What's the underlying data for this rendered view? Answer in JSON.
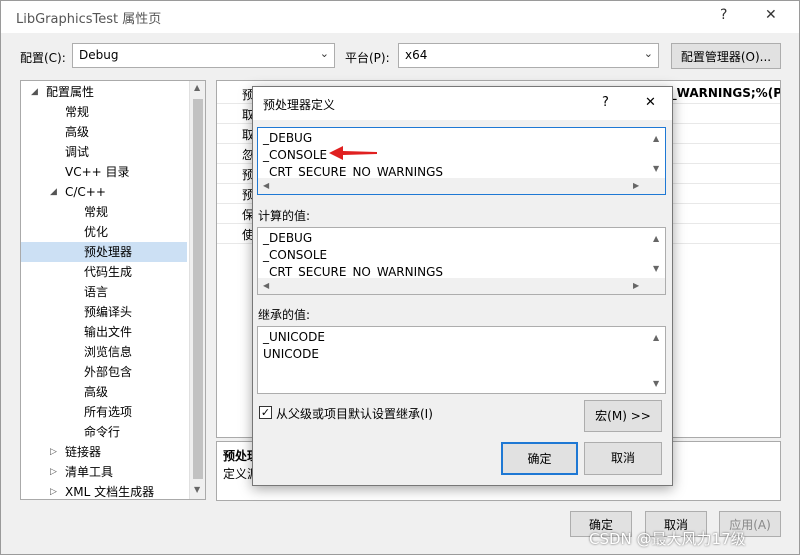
{
  "window": {
    "title": "LibGraphicsTest 属性页",
    "help_glyph": "?",
    "close_glyph": "✕"
  },
  "config_bar": {
    "config_label": "配置(C):",
    "config_value": "Debug",
    "platform_label": "平台(P):",
    "platform_value": "x64",
    "config_manager_label": "配置管理器(O)..."
  },
  "tree": {
    "items": [
      {
        "label": "配置属性",
        "expander": "◢"
      },
      {
        "label": "常规"
      },
      {
        "label": "高级"
      },
      {
        "label": "调试"
      },
      {
        "label": "VC++ 目录"
      },
      {
        "label": "C/C++",
        "expander": "◢"
      },
      {
        "label": "常规"
      },
      {
        "label": "优化"
      },
      {
        "label": "预处理器"
      },
      {
        "label": "代码生成"
      },
      {
        "label": "语言"
      },
      {
        "label": "预编译头"
      },
      {
        "label": "输出文件"
      },
      {
        "label": "浏览信息"
      },
      {
        "label": "外部包含"
      },
      {
        "label": "高级"
      },
      {
        "label": "所有选项"
      },
      {
        "label": "命令行"
      },
      {
        "label": "链接器",
        "expander": "▷"
      },
      {
        "label": "清单工具",
        "expander": "▷"
      },
      {
        "label": "XML 文档生成器",
        "expander": "▷"
      }
    ]
  },
  "grid": {
    "rows": [
      {
        "name": "预",
        "value": "D_WARNINGS;%(P"
      },
      {
        "name": "取",
        "value": ""
      },
      {
        "name": "取",
        "value": ""
      },
      {
        "name": "忽",
        "value": ""
      },
      {
        "name": "预",
        "value": ""
      },
      {
        "name": "预",
        "value": ""
      },
      {
        "name": "保",
        "value": ""
      },
      {
        "name": "使",
        "value": ""
      }
    ]
  },
  "description": {
    "title": "预处理",
    "text": "定义源"
  },
  "footer": {
    "ok_label": "确定",
    "cancel_label": "取消",
    "apply_label": "应用(A)",
    "watermark": "CSDN @最大风力17级"
  },
  "dialog": {
    "title": "预处理器定义",
    "help_glyph": "?",
    "close_glyph": "✕",
    "edit_lines": [
      "_DEBUG",
      "_CONSOLE",
      "_CRT_SECURE_NO_WARNINGS"
    ],
    "computed_label": "计算的值:",
    "computed_lines": [
      "_DEBUG",
      "_CONSOLE",
      "_CRT_SECURE_NO_WARNINGS"
    ],
    "inherited_label": "继承的值:",
    "inherited_lines": [
      "_UNICODE",
      "UNICODE"
    ],
    "inherit_checkbox_label": "从父级或项目默认设置继承(I)",
    "inherit_checked": true,
    "macro_button_label": "宏(M) >>",
    "ok_label": "确定",
    "cancel_label": "取消",
    "annotation_arrow_color": "#e02020"
  }
}
